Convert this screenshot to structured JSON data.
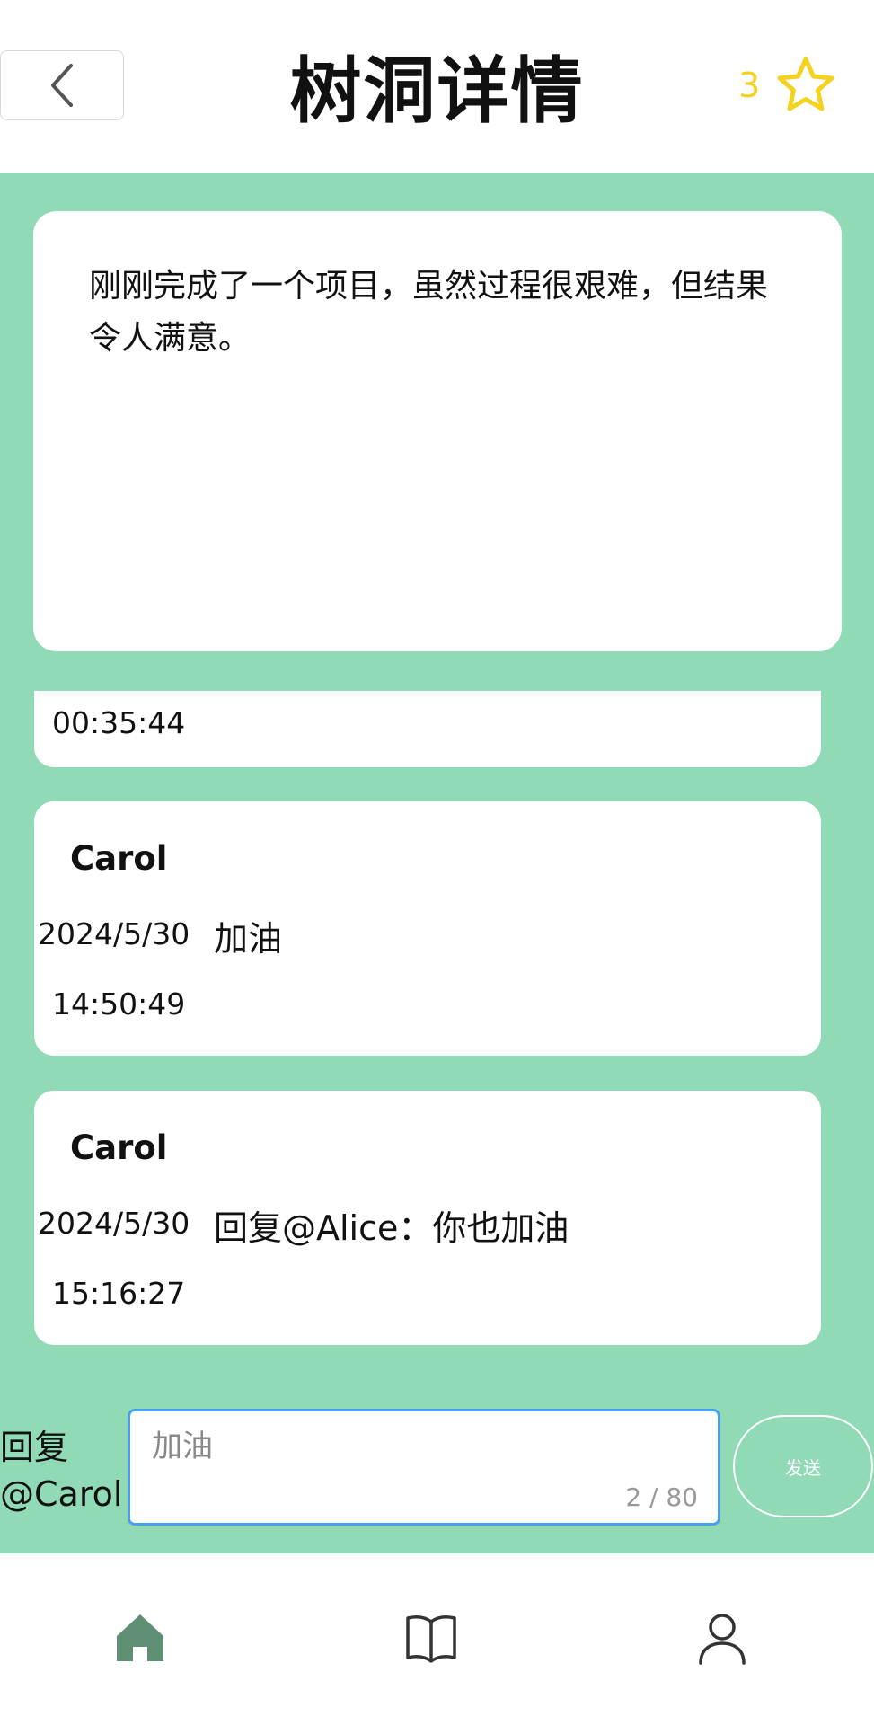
{
  "header": {
    "title": "树洞详情",
    "favorite_count": "3",
    "back_icon": "chevron-left-icon",
    "favorite_icon": "star-outline-icon",
    "star_color": "#f4d21f"
  },
  "post": {
    "content": "刚刚完成了一个项目，虽然过程很艰难，但结果令人满意。"
  },
  "comments": [
    {
      "name": "",
      "date": "",
      "time": "00:35:44",
      "text": ""
    },
    {
      "name": "Carol",
      "date": "2024/5/30",
      "time": "14:50:49",
      "text": "加油"
    },
    {
      "name": "Carol",
      "date": "2024/5/30",
      "time": "15:16:27",
      "text": "回复@Alice：你也加油"
    }
  ],
  "reply": {
    "label": "回复@Carol",
    "value": "加油",
    "counter": "2 / 80",
    "send_label": "发送"
  },
  "nav": {
    "items": [
      {
        "name": "home",
        "icon": "home-icon",
        "active": true
      },
      {
        "name": "book",
        "icon": "book-open-icon",
        "active": false
      },
      {
        "name": "profile",
        "icon": "user-icon",
        "active": false
      }
    ],
    "active_color": "#5f8f73"
  },
  "colors": {
    "background_green": "#90dab6",
    "input_border": "#4b9ff0"
  }
}
